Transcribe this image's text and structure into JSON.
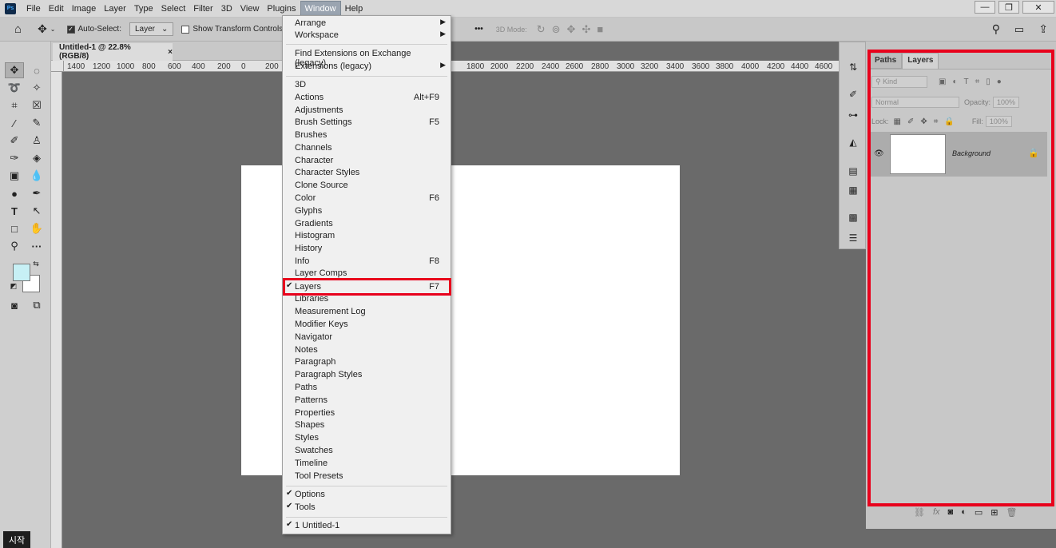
{
  "app": {
    "logo": "Ps"
  },
  "menubar": {
    "items": [
      "File",
      "Edit",
      "Image",
      "Layer",
      "Type",
      "Select",
      "Filter",
      "3D",
      "View",
      "Plugins",
      "Window",
      "Help"
    ],
    "active": "Window",
    "window_buttons": [
      "—",
      "❐",
      "✕"
    ]
  },
  "options": {
    "auto_select_label": "Auto-Select:",
    "auto_select_value": "Layer",
    "show_transform_label": "Show Transform Controls",
    "more": "•••",
    "mode3d": "3D Mode:"
  },
  "document": {
    "tab_title": "Untitled-1 @ 22.8% (RGB/8)",
    "tab_close": "×"
  },
  "ruler": {
    "top_ticks": [
      "1400",
      "1200",
      "1000",
      "800",
      "600",
      "400",
      "200",
      "0",
      "200",
      "1800",
      "2000",
      "2200",
      "2400",
      "2600",
      "2800",
      "3000",
      "3200",
      "3400",
      "3600",
      "3800",
      "4000",
      "4200",
      "4400",
      "4600"
    ]
  },
  "window_menu": {
    "items": [
      {
        "label": "Arrange",
        "arrow": "▶"
      },
      {
        "label": "Workspace",
        "arrow": "▶"
      },
      {
        "label": "Find Extensions on Exchange (legacy)..."
      },
      {
        "label": "Extensions (legacy)",
        "arrow": "▶"
      },
      {
        "label": "3D"
      },
      {
        "label": "Actions",
        "shortcut": "Alt+F9"
      },
      {
        "label": "Adjustments"
      },
      {
        "label": "Brush Settings",
        "shortcut": "F5"
      },
      {
        "label": "Brushes"
      },
      {
        "label": "Channels"
      },
      {
        "label": "Character"
      },
      {
        "label": "Character Styles"
      },
      {
        "label": "Clone Source"
      },
      {
        "label": "Color",
        "shortcut": "F6"
      },
      {
        "label": "Glyphs"
      },
      {
        "label": "Gradients"
      },
      {
        "label": "Histogram"
      },
      {
        "label": "History"
      },
      {
        "label": "Info",
        "shortcut": "F8"
      },
      {
        "label": "Layer Comps"
      },
      {
        "label": "Layers",
        "shortcut": "F7",
        "checked": "✔"
      },
      {
        "label": "Libraries"
      },
      {
        "label": "Measurement Log"
      },
      {
        "label": "Modifier Keys"
      },
      {
        "label": "Navigator"
      },
      {
        "label": "Notes"
      },
      {
        "label": "Paragraph"
      },
      {
        "label": "Paragraph Styles"
      },
      {
        "label": "Paths"
      },
      {
        "label": "Patterns"
      },
      {
        "label": "Properties"
      },
      {
        "label": "Shapes"
      },
      {
        "label": "Styles"
      },
      {
        "label": "Swatches"
      },
      {
        "label": "Timeline"
      },
      {
        "label": "Tool Presets"
      },
      {
        "label": "Options",
        "checked": "✔"
      },
      {
        "label": "Tools",
        "checked": "✔"
      },
      {
        "label": "1 Untitled-1",
        "checked": "✔"
      }
    ]
  },
  "layers_panel": {
    "tabs": [
      "Paths",
      "Layers"
    ],
    "active_tab": "Layers",
    "filter_placeholder": "Kind",
    "blend_mode": "Normal",
    "opacity_label": "Opacity:",
    "opacity_value": "100%",
    "lock_label": "Lock:",
    "fill_label": "Fill:",
    "fill_value": "100%",
    "layers": [
      {
        "name": "Background",
        "visible": true,
        "locked": true
      }
    ]
  },
  "taskbar": {
    "start_label": "시작"
  },
  "colors": {
    "highlight": "#e8001c",
    "foreground_swatch": "#c7f0f5",
    "background_swatch": "#ffffff"
  }
}
